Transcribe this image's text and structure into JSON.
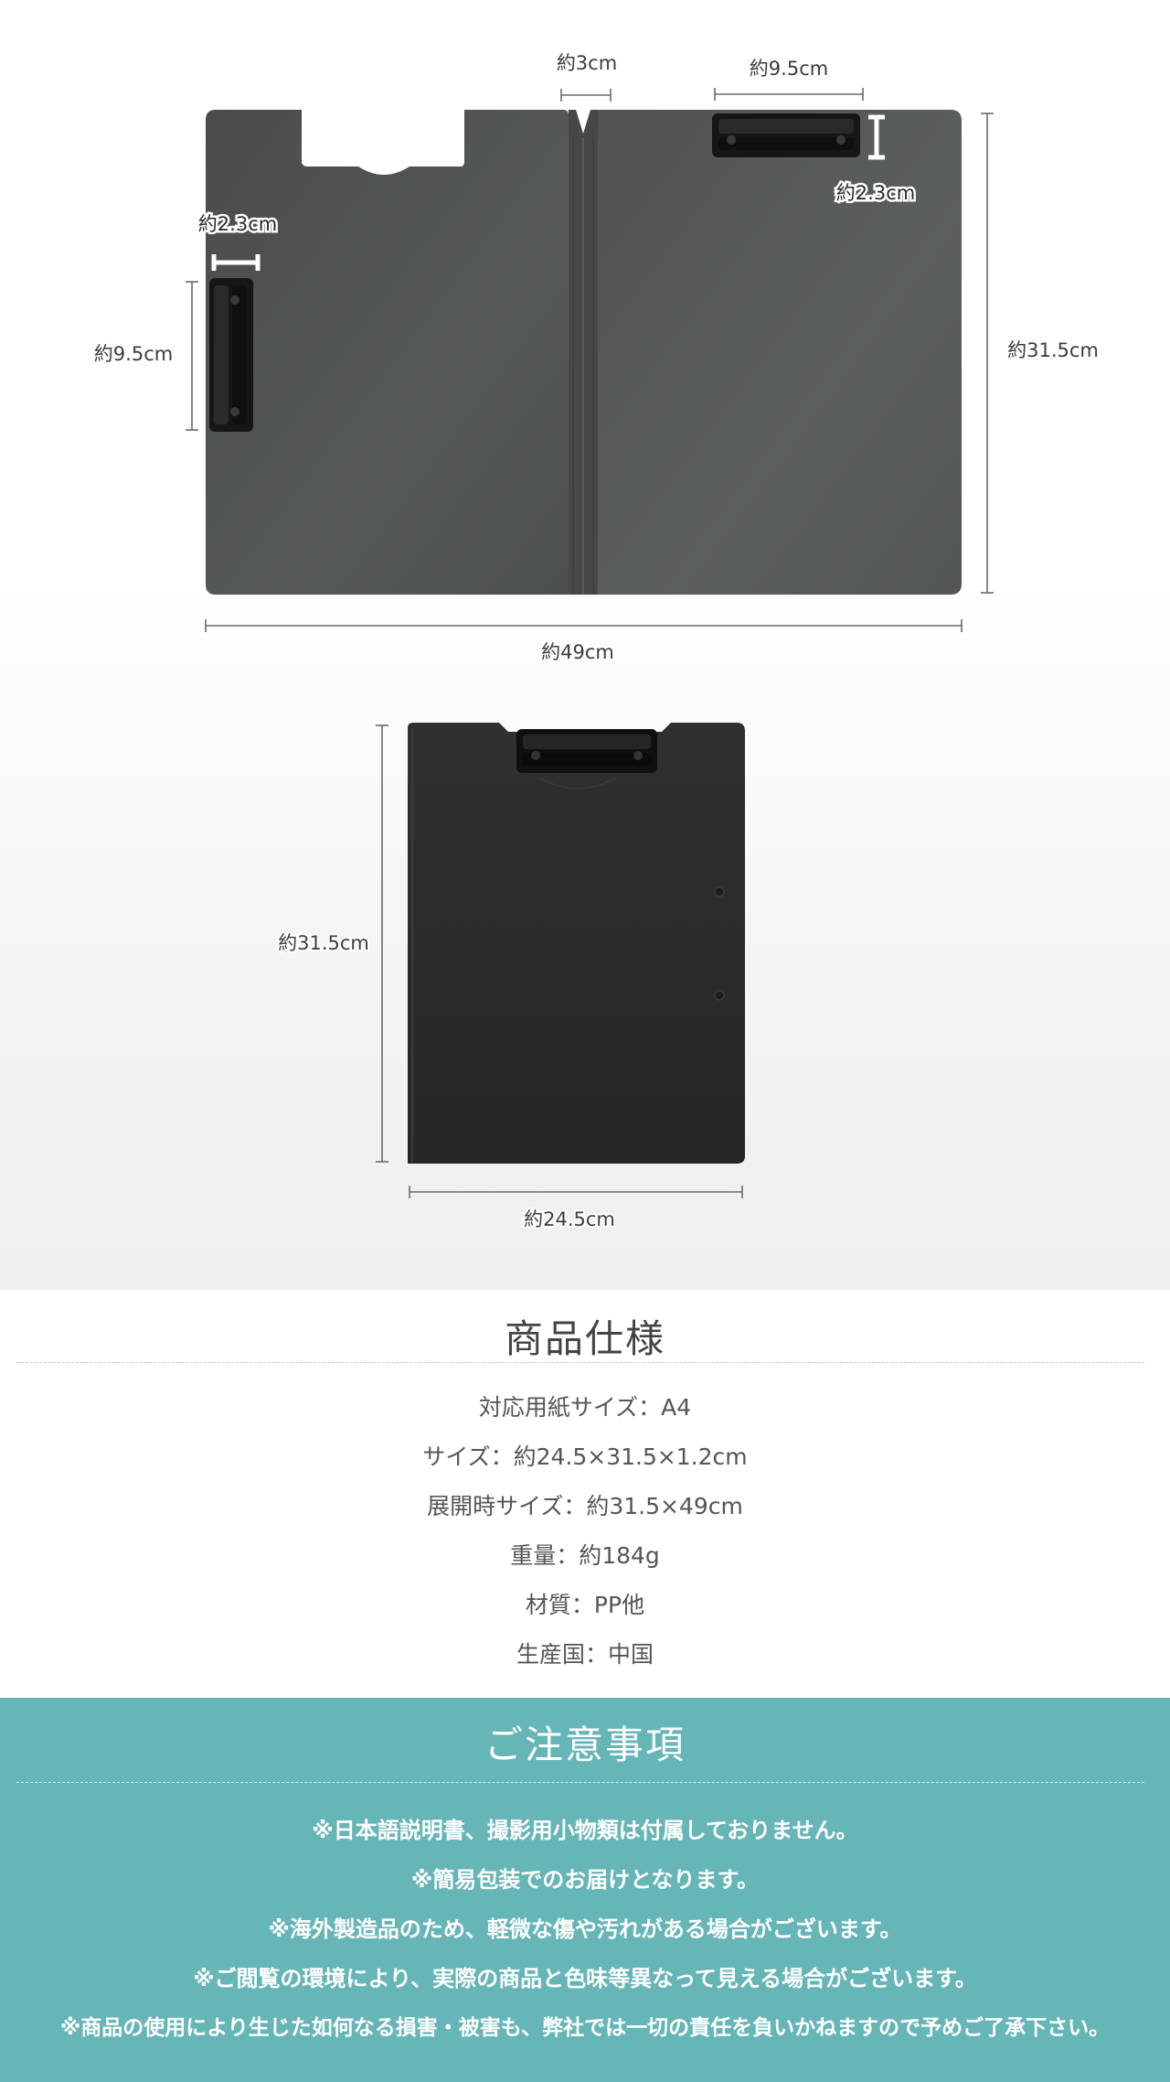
{
  "dimensions": {
    "open_spine_width": "約3cm",
    "open_top_clip_width": "約9.5cm",
    "open_top_clip_height": "約2.3cm",
    "open_left_clip_depth": "約2.3cm",
    "open_left_clip_length": "約9.5cm",
    "open_height": "約31.5cm",
    "open_width": "約49cm",
    "closed_height": "約31.5cm",
    "closed_width": "約24.5cm"
  },
  "colors": {
    "open_board": "#505353",
    "closed_board": "#2b2b2b",
    "clip": "#1a1a1a",
    "caution_background": "#66b5b7"
  },
  "spec": {
    "title": "商品仕様",
    "items": [
      "対応用紙サイズ：A4",
      "サイズ：約24.5×31.5×1.2cm",
      "展開時サイズ：約31.5×49cm",
      "重量：約184g",
      "材質：PP他",
      "生産国：中国"
    ]
  },
  "caution": {
    "title": "ご注意事項",
    "items": [
      "※日本語説明書、撮影用小物類は付属しておりません。",
      "※簡易包装でのお届けとなります。",
      "※海外製造品のため、軽微な傷や汚れがある場合がございます。",
      "※ご閲覧の環境により、実際の商品と色味等異なって見える場合がございます。",
      "※商品の使用により生じた如何なる損害・被害も、弊社では一切の責任を負いかねますので予めご了承下さい。"
    ]
  }
}
